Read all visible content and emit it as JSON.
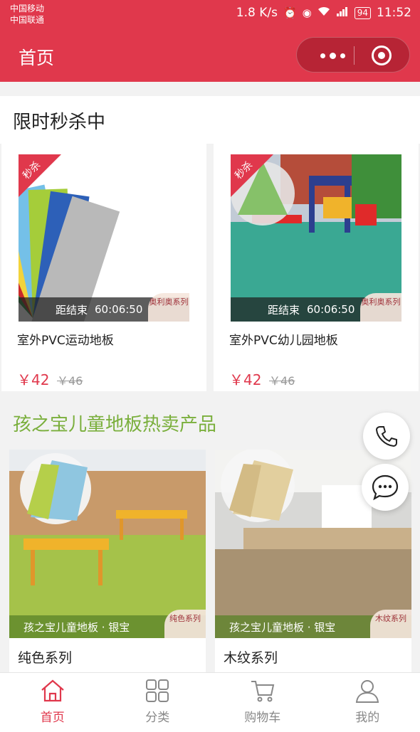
{
  "status_bar": {
    "carrier_1": "中国移动",
    "carrier_2": "中国联通",
    "speed": "1.8 K/s",
    "battery": "94",
    "time": "11:52"
  },
  "header": {
    "title": "首页",
    "accent_color": "#e0384c"
  },
  "flash_sale": {
    "title": "限时秒杀中",
    "ribbon_label": "秒杀",
    "countdown_label": "距结束",
    "items": [
      {
        "name": "室外PVC运动地板",
        "countdown": "60:06:50",
        "price": "￥42",
        "original_price": "￥46",
        "corner_badge": "奥利奥系列"
      },
      {
        "name": "室外PVC幼儿园地板",
        "countdown": "60:06:50",
        "price": "￥42",
        "original_price": "￥46",
        "corner_badge": "奥利奥系列"
      }
    ]
  },
  "hot_products": {
    "title": "孩之宝儿童地板热卖产品",
    "title_color": "#7aaf3c",
    "items": [
      {
        "name": "纯色系列",
        "caption": "孩之宝儿童地板 · 银宝",
        "corner_badge": "纯色系列"
      },
      {
        "name": "木纹系列",
        "caption": "孩之宝儿童地板 · 银宝",
        "corner_badge": "木纹系列"
      }
    ]
  },
  "floating": {
    "phone_icon": "phone-icon",
    "chat_icon": "chat-bubble-icon"
  },
  "tabbar": {
    "items": [
      {
        "label": "首页",
        "icon": "home-icon",
        "active": true
      },
      {
        "label": "分类",
        "icon": "grid-icon",
        "active": false
      },
      {
        "label": "购物车",
        "icon": "cart-icon",
        "active": false
      },
      {
        "label": "我的",
        "icon": "user-icon",
        "active": false
      }
    ]
  }
}
